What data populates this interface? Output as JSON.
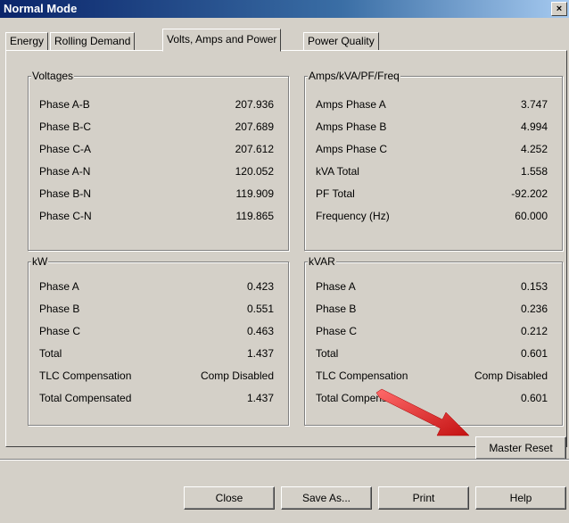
{
  "window": {
    "title": "Normal Mode",
    "close_label": "×"
  },
  "tabs": [
    {
      "label": "Energy"
    },
    {
      "label": "Rolling Demand"
    },
    {
      "label": "Volts, Amps and Power"
    },
    {
      "label": "Power Quality"
    }
  ],
  "groups": {
    "voltages": {
      "title": "Voltages",
      "rows": [
        {
          "label": "Phase A-B",
          "value": "207.936"
        },
        {
          "label": "Phase B-C",
          "value": "207.689"
        },
        {
          "label": "Phase C-A",
          "value": "207.612"
        },
        {
          "label": "Phase A-N",
          "value": "120.052"
        },
        {
          "label": "Phase B-N",
          "value": "119.909"
        },
        {
          "label": "Phase C-N",
          "value": "119.865"
        }
      ]
    },
    "amps": {
      "title": "Amps/kVA/PF/Freq",
      "rows": [
        {
          "label": "Amps Phase A",
          "value": "3.747"
        },
        {
          "label": "Amps Phase B",
          "value": "4.994"
        },
        {
          "label": "Amps Phase C",
          "value": "4.252"
        },
        {
          "label": "kVA Total",
          "value": "1.558"
        },
        {
          "label": "PF Total",
          "value": "-92.202"
        },
        {
          "label": "Frequency (Hz)",
          "value": "60.000"
        }
      ]
    },
    "kw": {
      "title": "kW",
      "rows": [
        {
          "label": "Phase A",
          "value": "0.423"
        },
        {
          "label": "Phase B",
          "value": "0.551"
        },
        {
          "label": "Phase C",
          "value": "0.463"
        },
        {
          "label": "Total",
          "value": "1.437"
        },
        {
          "label": "TLC Compensation",
          "value": "Comp Disabled"
        },
        {
          "label": "Total Compensated",
          "value": "1.437"
        }
      ]
    },
    "kvar": {
      "title": "kVAR",
      "rows": [
        {
          "label": "Phase A",
          "value": "0.153"
        },
        {
          "label": "Phase B",
          "value": "0.236"
        },
        {
          "label": "Phase C",
          "value": "0.212"
        },
        {
          "label": "Total",
          "value": "0.601"
        },
        {
          "label": "TLC Compensation",
          "value": "Comp Disabled"
        },
        {
          "label": "Total Compensa",
          "value": "0.601"
        }
      ]
    }
  },
  "buttons": {
    "master_reset": "Master Reset",
    "close": "Close",
    "save_as": "Save As...",
    "print": "Print",
    "help": "Help"
  },
  "colors": {
    "titlebar": "#0a246a",
    "face": "#d4d0c8",
    "arrow": "#e02020"
  },
  "annotation": {
    "icon": "red-arrow-icon"
  }
}
